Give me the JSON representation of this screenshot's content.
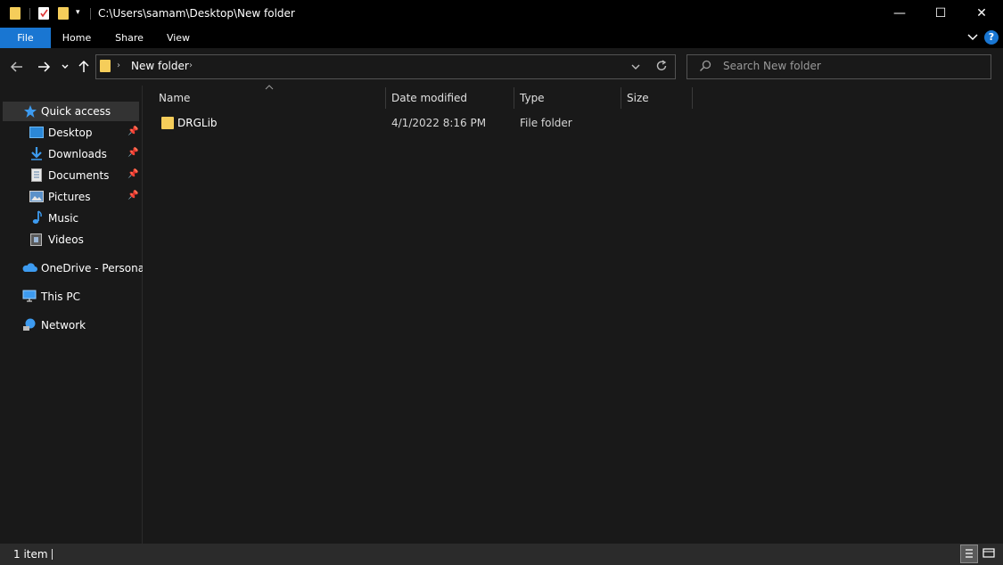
{
  "window": {
    "title": "C:\\Users\\samam\\Desktop\\New folder",
    "minimize_glyph": "—",
    "maximize_glyph": "☐",
    "close_glyph": "✕"
  },
  "ribbon": {
    "tabs": [
      "File",
      "Home",
      "Share",
      "View"
    ],
    "help_glyph": "?"
  },
  "address": {
    "breadcrumb": "New folder",
    "search_placeholder": "Search New folder"
  },
  "columns": {
    "name": "Name",
    "date": "Date modified",
    "type": "Type",
    "size": "Size"
  },
  "files": [
    {
      "name": "DRGLib",
      "date": "4/1/2022 8:16 PM",
      "type": "File folder",
      "size": ""
    }
  ],
  "sidebar": {
    "quick_access": "Quick access",
    "items": [
      {
        "label": "Desktop",
        "pinned": true
      },
      {
        "label": "Downloads",
        "pinned": true
      },
      {
        "label": "Documents",
        "pinned": true
      },
      {
        "label": "Pictures",
        "pinned": true
      },
      {
        "label": "Music",
        "pinned": false
      },
      {
        "label": "Videos",
        "pinned": false
      }
    ],
    "onedrive": "OneDrive - Personal",
    "thispc": "This PC",
    "network": "Network"
  },
  "status": {
    "item_count": "1 item"
  },
  "colors": {
    "accent": "#1976d2",
    "folder": "#f5cd5a"
  }
}
